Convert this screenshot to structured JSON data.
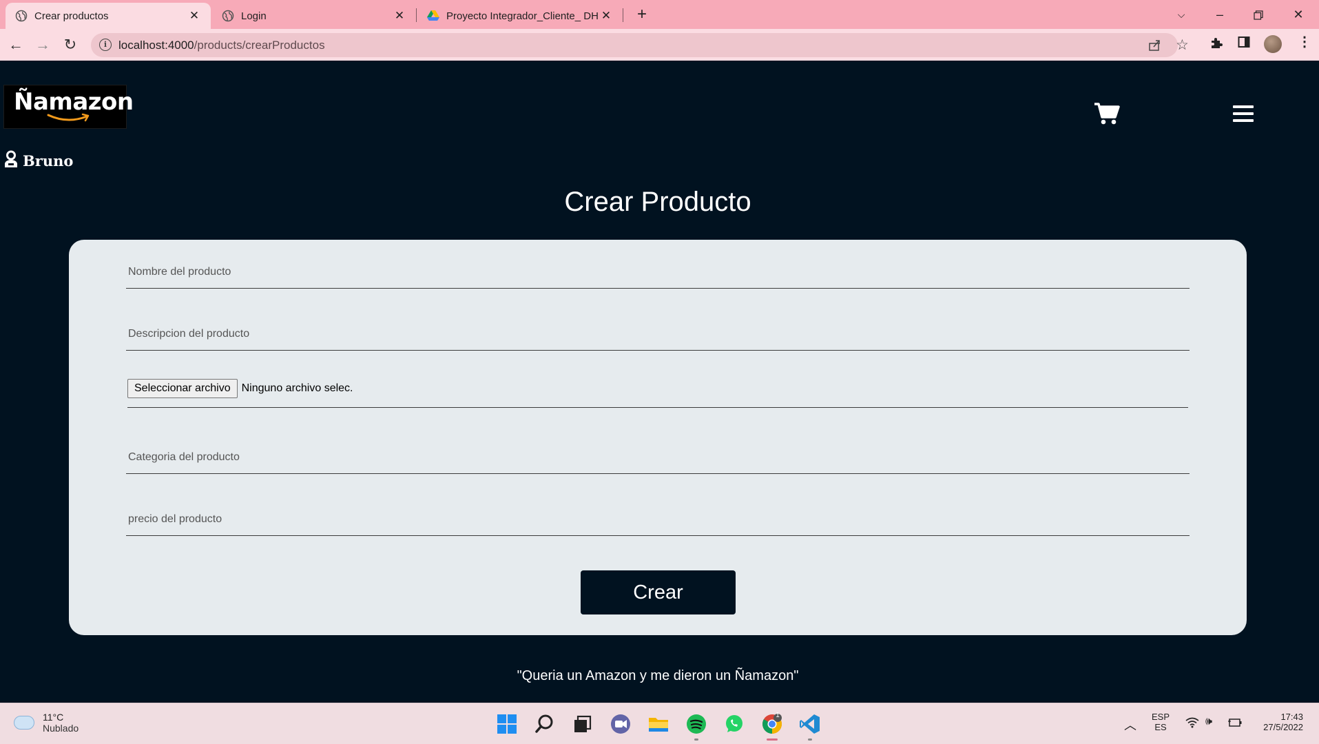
{
  "browser": {
    "tabs": [
      {
        "title": "Crear productos",
        "active": true
      },
      {
        "title": "Login",
        "active": false
      },
      {
        "title": "Proyecto Integrador_Cliente_ DH",
        "active": false
      }
    ],
    "url_host": "localhost:4000",
    "url_path": "/products/crearProductos"
  },
  "site": {
    "logo_text": "Ñamazon",
    "user_name": "Bruno",
    "page_title": "Crear Producto",
    "footer_quote": "\"Queria un Amazon y me dieron un Ñamazon\""
  },
  "form": {
    "name_placeholder": "Nombre del producto",
    "description_placeholder": "Descripcion del producto",
    "file_button_label": "Seleccionar archivo",
    "file_status": "Ninguno archivo selec.",
    "category_placeholder": "Categoria del producto",
    "price_placeholder": "precio del producto",
    "submit_label": "Crear"
  },
  "taskbar": {
    "weather_temp": "11°C",
    "weather_desc": "Nublado",
    "lang_top": "ESP",
    "lang_bottom": "ES",
    "time": "17:43",
    "date": "27/5/2022",
    "chrome_badge": "1"
  },
  "icons": [
    "globe-icon",
    "drive-icon",
    "close-icon",
    "plus-icon",
    "back-arrow-icon",
    "forward-arrow-icon",
    "reload-icon",
    "info-icon",
    "share-icon",
    "star-icon",
    "puzzle-icon",
    "sidepanel-icon",
    "menu-dots-icon",
    "cart-icon",
    "hamburger-icon",
    "user-icon",
    "windows-icon",
    "search-icon",
    "task-view-icon",
    "chat-icon",
    "folder-icon",
    "spotify-icon",
    "whatsapp-icon",
    "chrome-icon",
    "vscode-icon",
    "wifi-icon",
    "volume-icon",
    "battery-icon",
    "chevron-up-icon"
  ]
}
